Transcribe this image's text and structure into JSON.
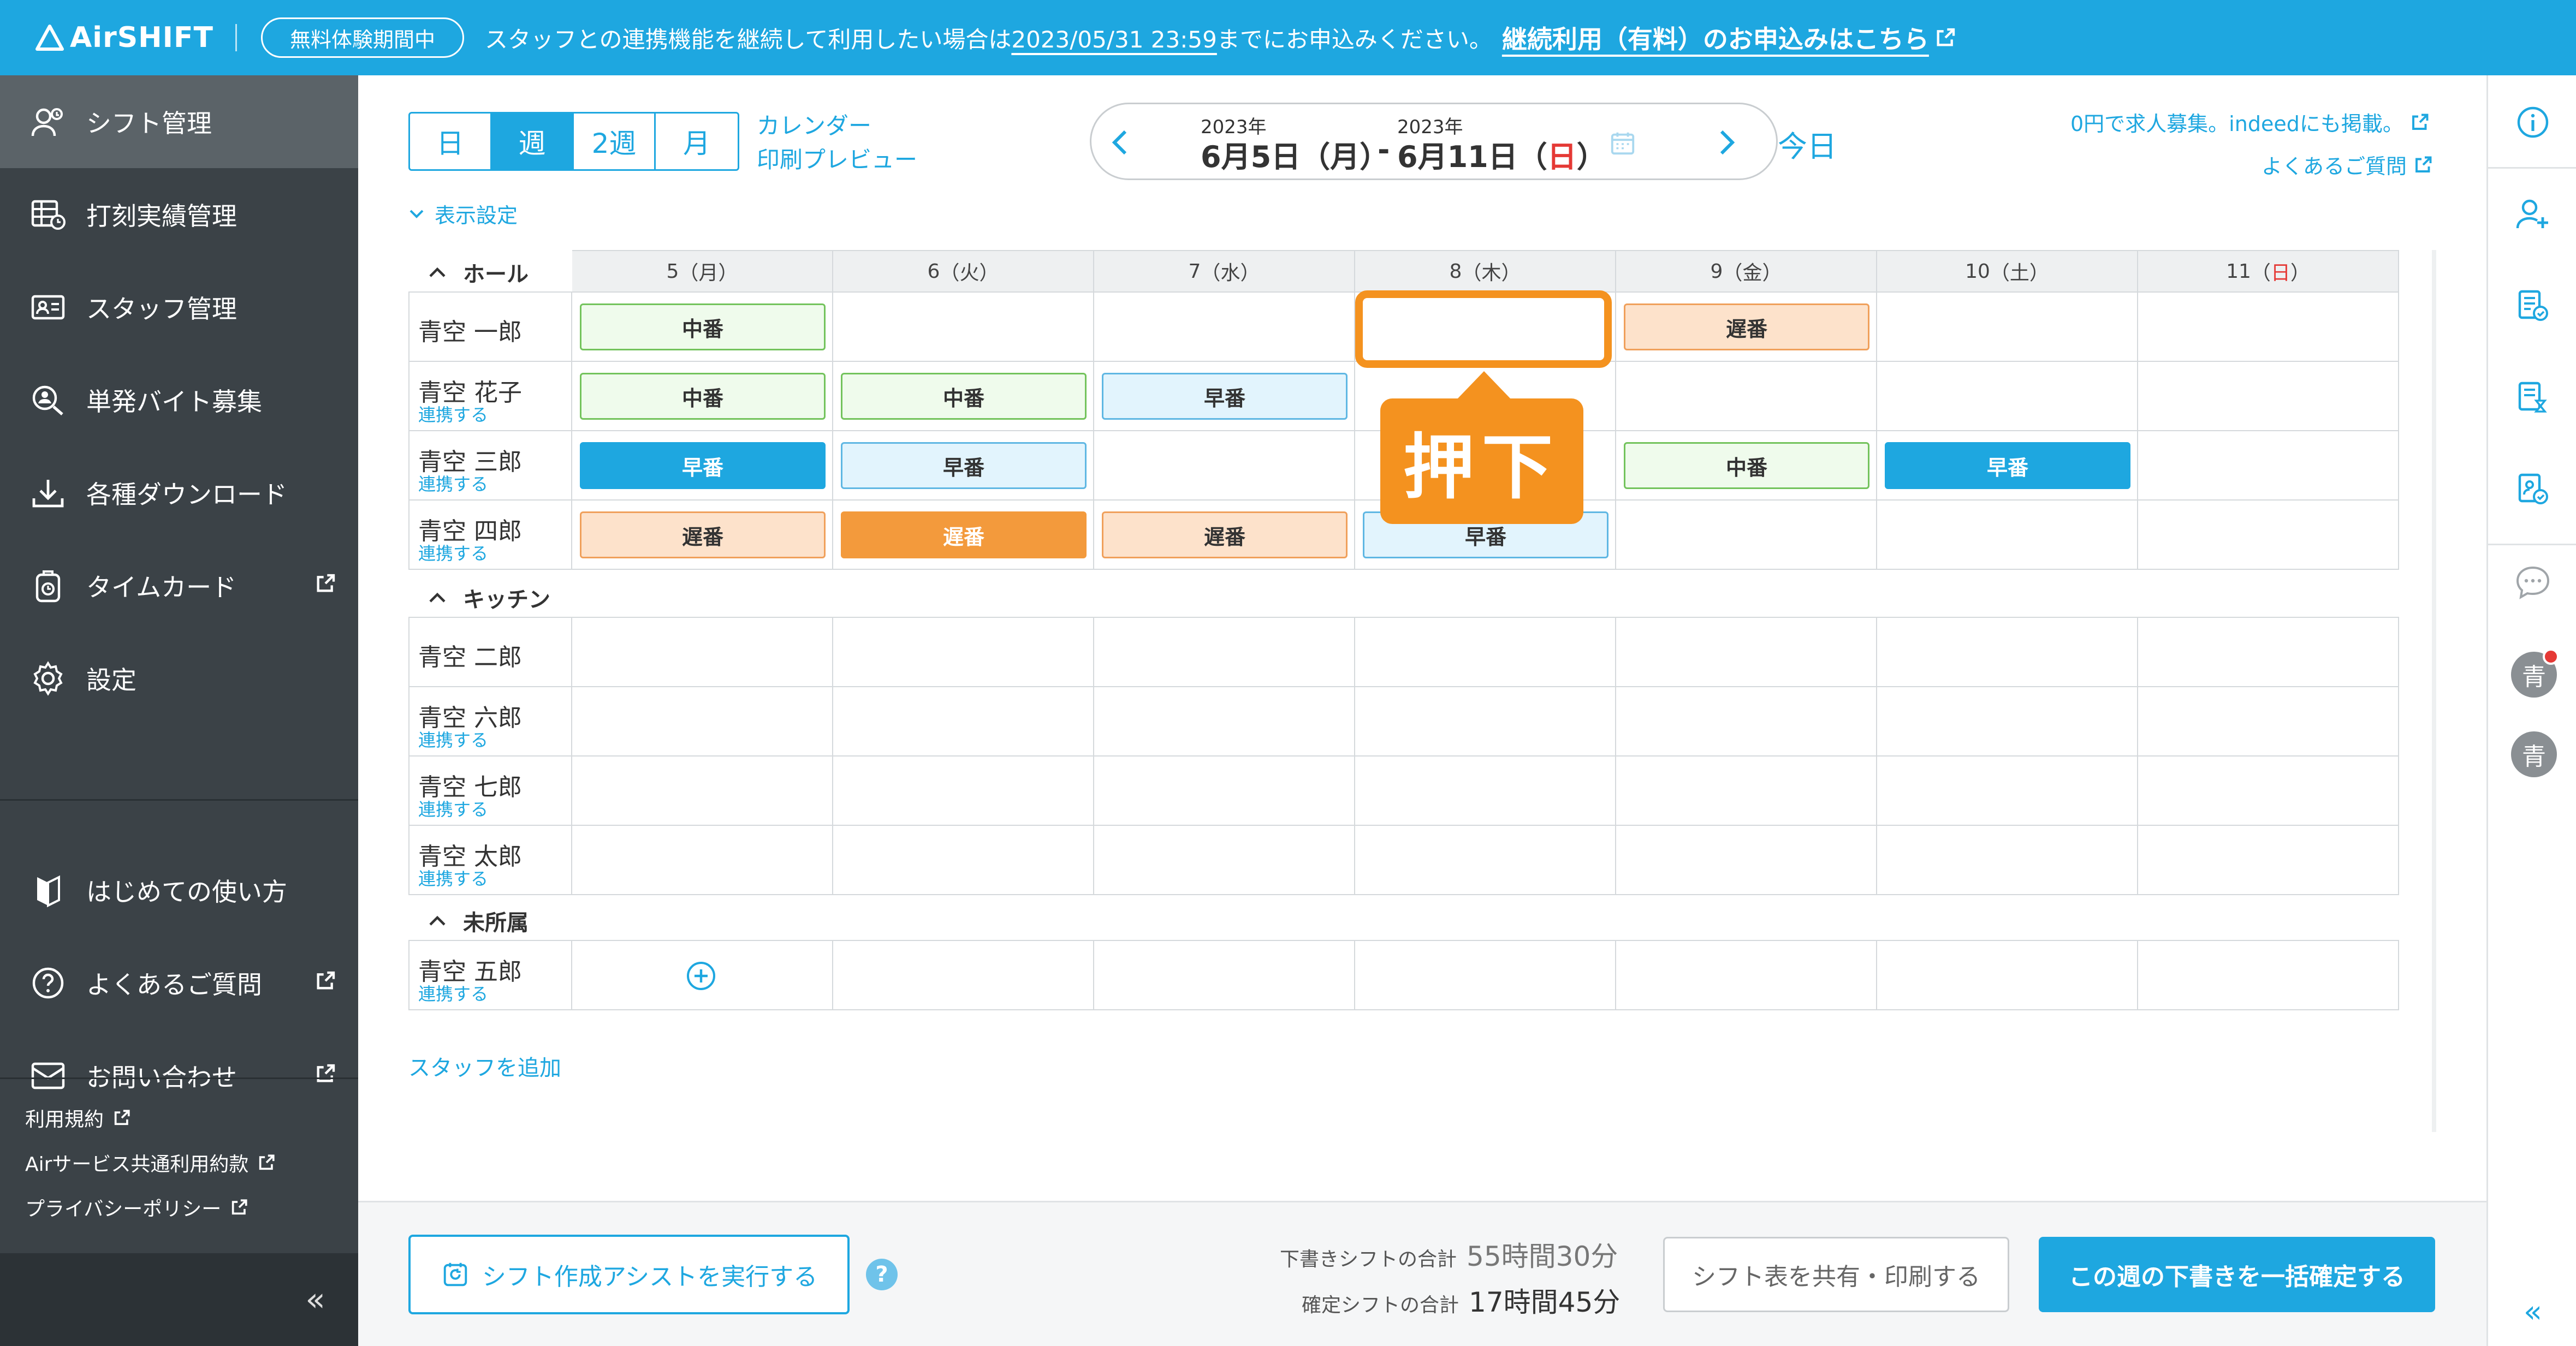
{
  "banner": {
    "logo": "AirSHIFT",
    "trial": "無料体験期間中",
    "msg_prefix": "スタッフとの連携機能を継続して利用したい場合は",
    "msg_date": "2023/05/31 23:59",
    "msg_suffix": "までにお申込みください。",
    "cta": "継続利用（有料）のお申込みはこちら"
  },
  "sidebar": {
    "items": [
      {
        "label": "シフト管理",
        "icon": "shift-people-icon",
        "active": true
      },
      {
        "label": "打刻実績管理",
        "icon": "timesheet-icon"
      },
      {
        "label": "スタッフ管理",
        "icon": "staff-card-icon"
      },
      {
        "label": "単発バイト募集",
        "icon": "search-person-icon"
      },
      {
        "label": "各種ダウンロード",
        "icon": "download-icon"
      },
      {
        "label": "タイムカード",
        "icon": "timecard-icon",
        "external": true
      },
      {
        "label": "設定",
        "icon": "gear-icon"
      },
      {
        "label": "はじめての使い方",
        "icon": "beginner-icon"
      },
      {
        "label": "よくあるご質問",
        "icon": "question-icon",
        "external": true
      },
      {
        "label": "お問い合わせ",
        "icon": "mail-icon",
        "external": true
      }
    ],
    "small_links": [
      "利用規約",
      "Airサービス共通利用約款",
      "プライバシーポリシー"
    ],
    "collapse": "«"
  },
  "toolbar": {
    "views": [
      "日",
      "週",
      "2週",
      "月"
    ],
    "selected_view": "週",
    "calendar_link": "カレンダー",
    "print_link": "印刷プレビュー",
    "week_start_year": "2023年",
    "week_start": "6月5日（月）",
    "dash": "-",
    "week_end_year": "2023年",
    "week_end_prefix": "6月11日（",
    "week_end_day": "日",
    "week_end_suffix": "）",
    "today": "今日",
    "recruit_link": "0円で求人募集。indeedにも掲載。",
    "faq_link": "よくあるご質問",
    "display_settings": "表示設定"
  },
  "days": [
    {
      "num": "5",
      "dow": "月"
    },
    {
      "num": "6",
      "dow": "火"
    },
    {
      "num": "7",
      "dow": "水"
    },
    {
      "num": "8",
      "dow": "木"
    },
    {
      "num": "9",
      "dow": "金"
    },
    {
      "num": "10",
      "dow": "土"
    },
    {
      "num": "11",
      "dow": "日"
    }
  ],
  "groups": [
    {
      "name": "ホール",
      "staff": [
        {
          "name": "青空 一郎",
          "link": ""
        },
        {
          "name": "青空 花子",
          "link": "連携する"
        },
        {
          "name": "青空 三郎",
          "link": "連携する"
        },
        {
          "name": "青空 四郎",
          "link": "連携する"
        }
      ]
    },
    {
      "name": "キッチン",
      "staff": [
        {
          "name": "青空 二郎",
          "link": ""
        },
        {
          "name": "青空 六郎",
          "link": "連携する"
        },
        {
          "name": "青空 七郎",
          "link": "連携する"
        },
        {
          "name": "青空 太郎",
          "link": "連携する"
        }
      ]
    },
    {
      "name": "未所属",
      "staff": [
        {
          "name": "青空 五郎",
          "link": "連携する"
        }
      ]
    }
  ],
  "shifts": [
    {
      "row": 0,
      "day": 0,
      "label": "中番",
      "kind": "s-mid"
    },
    {
      "row": 0,
      "day": 4,
      "label": "遅番",
      "kind": "s-late"
    },
    {
      "row": 1,
      "day": 0,
      "label": "中番",
      "kind": "s-mid"
    },
    {
      "row": 1,
      "day": 1,
      "label": "中番",
      "kind": "s-mid"
    },
    {
      "row": 1,
      "day": 2,
      "label": "早番",
      "kind": "s-early"
    },
    {
      "row": 2,
      "day": 0,
      "label": "早番",
      "kind": "s-early-solid"
    },
    {
      "row": 2,
      "day": 1,
      "label": "早番",
      "kind": "s-early"
    },
    {
      "row": 2,
      "day": 4,
      "label": "中番",
      "kind": "s-mid"
    },
    {
      "row": 2,
      "day": 5,
      "label": "早番",
      "kind": "s-early-solid"
    },
    {
      "row": 3,
      "day": 0,
      "label": "遅番",
      "kind": "s-late"
    },
    {
      "row": 3,
      "day": 1,
      "label": "遅番",
      "kind": "s-late-solid"
    },
    {
      "row": 3,
      "day": 2,
      "label": "遅番",
      "kind": "s-late"
    },
    {
      "row": 3,
      "day": 3,
      "label": "早番",
      "kind": "s-early"
    }
  ],
  "callout": "押下",
  "add_staff": "スタッフを追加",
  "footer": {
    "assist": "シフト作成アシストを実行する",
    "help": "?",
    "draft_label": "下書きシフトの合計",
    "draft_value": "55時間30分",
    "confirmed_label": "確定シフトの合計",
    "confirmed_value": "17時間45分",
    "share": "シフト表を共有・印刷する",
    "confirm_all": "この週の下書きを一括確定する"
  },
  "rail": {
    "avatar1": "青",
    "avatar2": "青",
    "collapse": "«"
  },
  "colors": {
    "brand": "#1ea7e0",
    "sidebar": "#3b4247",
    "highlight": "#f4921f",
    "sunday": "#e53935"
  }
}
